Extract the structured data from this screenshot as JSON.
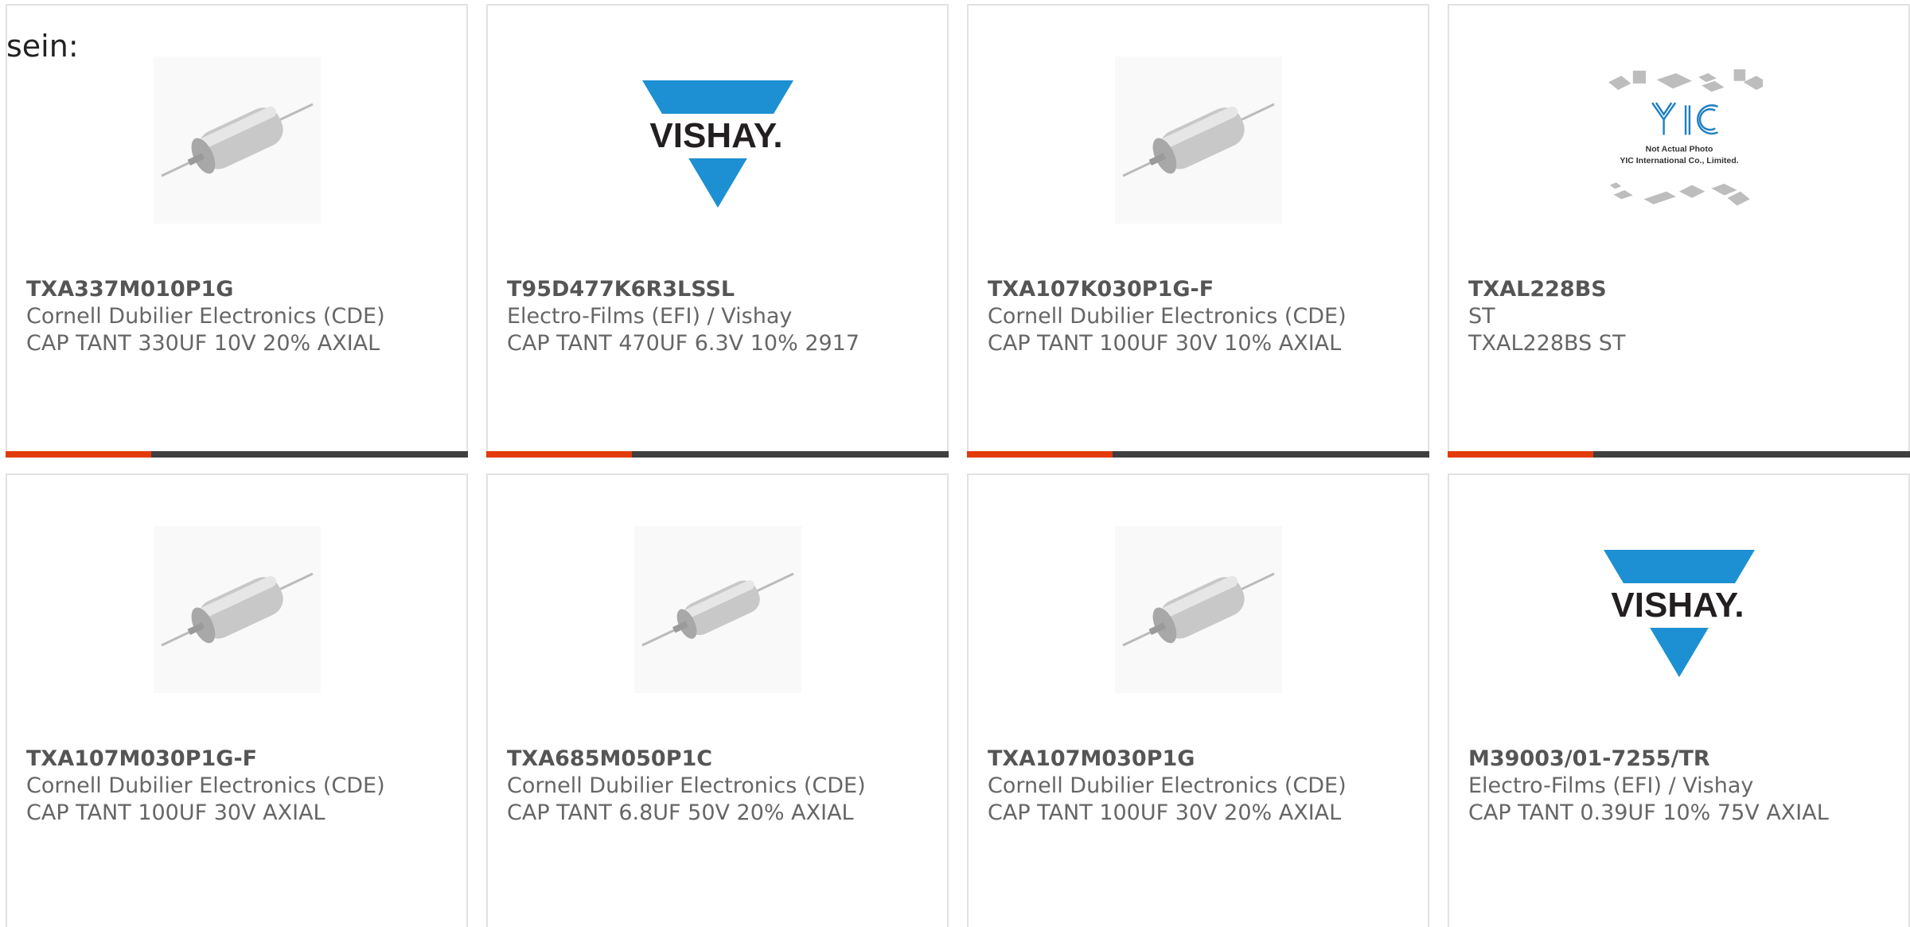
{
  "intro": "sein:",
  "colors": {
    "accent": "#e43b0c",
    "bar": "#3f3f3f",
    "vishay_blue": "#1d90d3"
  },
  "cards": [
    {
      "part": "TXA337M010P1G",
      "manufacturer": "Cornell Dubilier Electronics (CDE)",
      "description": "CAP TANT 330UF 10V 20% AXIAL",
      "image": "axial-capacitor-icon"
    },
    {
      "part": "T95D477K6R3LSSL",
      "manufacturer": "Electro-Films (EFI) / Vishay",
      "description": "CAP TANT 470UF 6.3V 10% 2917",
      "image": "vishay-logo",
      "logo_text": "VISHAY."
    },
    {
      "part": "TXA107K030P1G-F",
      "manufacturer": "Cornell Dubilier Electronics (CDE)",
      "description": "CAP TANT 100UF 30V 10% AXIAL",
      "image": "axial-capacitor-icon"
    },
    {
      "part": "TXAL228BS",
      "manufacturer": "ST",
      "description": "TXAL228BS ST",
      "image": "yic-placeholder",
      "logo_text": "YIC",
      "placeholder_line1": "Not Actual Photo",
      "placeholder_line2": "YIC International Co., Limited."
    },
    {
      "part": "TXA107M030P1G-F",
      "manufacturer": "Cornell Dubilier Electronics (CDE)",
      "description": "CAP TANT 100UF 30V AXIAL",
      "image": "axial-capacitor-icon"
    },
    {
      "part": "TXA685M050P1C",
      "manufacturer": "Cornell Dubilier Electronics (CDE)",
      "description": "CAP TANT 6.8UF 50V 20% AXIAL",
      "image": "axial-capacitor-icon"
    },
    {
      "part": "TXA107M030P1G",
      "manufacturer": "Cornell Dubilier Electronics (CDE)",
      "description": "CAP TANT 100UF 30V 20% AXIAL",
      "image": "axial-capacitor-icon"
    },
    {
      "part": "M39003/01-7255/TR",
      "manufacturer": "Electro-Films (EFI) / Vishay",
      "description": "CAP TANT 0.39UF 10% 75V AXIAL",
      "image": "vishay-logo",
      "logo_text": "VISHAY."
    }
  ]
}
